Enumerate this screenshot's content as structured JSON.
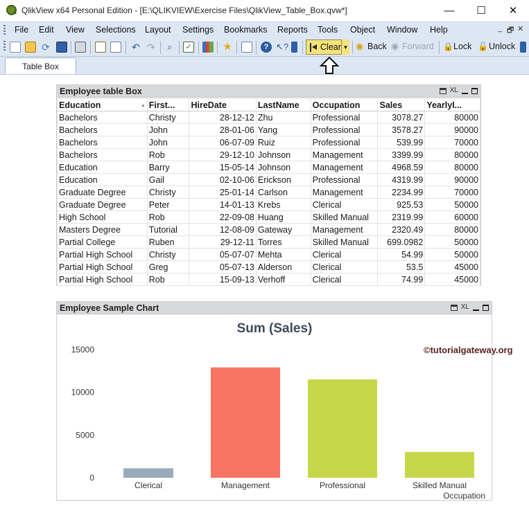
{
  "window": {
    "title": "QlikView x64 Personal Edition - [E:\\QLIKVIEW\\Exercise Files\\QlikView_Table_Box.qvw*]",
    "minimize": "—",
    "maximize": "☐",
    "close": "✕"
  },
  "menu": [
    "File",
    "Edit",
    "View",
    "Selections",
    "Layout",
    "Settings",
    "Bookmarks",
    "Reports",
    "Tools",
    "Object",
    "Window",
    "Help"
  ],
  "mdi_controls": {
    "minimize": "_",
    "restore": "🗗",
    "close": "✕"
  },
  "toolbar": {
    "clear_label": "Clear",
    "back_label": "Back",
    "forward_label": "Forward",
    "lock_label": "Lock",
    "unlock_label": "Unlock"
  },
  "tabs": [
    {
      "label": "Table Box"
    }
  ],
  "table_box": {
    "title": "Employee table Box",
    "xl_label": "XL",
    "columns": [
      "Education",
      "First...",
      "HireDate",
      "LastName",
      "Occupation",
      "Sales",
      "YearlyI..."
    ],
    "rows": [
      [
        "Bachelors",
        "Christy",
        "28-12-12",
        "Zhu",
        "Professional",
        "3078.27",
        "80000"
      ],
      [
        "Bachelors",
        "John",
        "28-01-06",
        "Yang",
        "Professional",
        "3578.27",
        "90000"
      ],
      [
        "Bachelors",
        "John",
        "06-07-09",
        "Ruiz",
        "Professional",
        "539.99",
        "70000"
      ],
      [
        "Bachelors",
        "Rob",
        "29-12-10",
        "Johnson",
        "Management",
        "3399.99",
        "80000"
      ],
      [
        "Education",
        "Barry",
        "15-05-14",
        "Johnson",
        "Management",
        "4968.59",
        "80000"
      ],
      [
        "Education",
        "Gail",
        "02-10-06",
        "Erickson",
        "Professional",
        "4319.99",
        "90000"
      ],
      [
        "Graduate Degree",
        "Christy",
        "25-01-14",
        "Carlson",
        "Management",
        "2234.99",
        "70000"
      ],
      [
        "Graduate Degree",
        "Peter",
        "14-01-13",
        "Krebs",
        "Clerical",
        "925.53",
        "50000"
      ],
      [
        "High School",
        "Rob",
        "22-09-08",
        "Huang",
        "Skilled Manual",
        "2319.99",
        "60000"
      ],
      [
        "Masters Degree",
        "Tutorial",
        "12-08-09",
        "Gateway",
        "Management",
        "2320.49",
        "80000"
      ],
      [
        "Partial College",
        "Ruben",
        "29-12-11",
        "Torres",
        "Skilled Manual",
        "699.0982",
        "50000"
      ],
      [
        "Partial High School",
        "Christy",
        "05-07-07",
        "Mehta",
        "Clerical",
        "54.99",
        "50000"
      ],
      [
        "Partial High School",
        "Greg",
        "05-07-13",
        "Alderson",
        "Clerical",
        "53.5",
        "45000"
      ],
      [
        "Partial High School",
        "Rob",
        "15-09-13",
        "Verhoff",
        "Clerical",
        "74.99",
        "45000"
      ]
    ]
  },
  "chart_object": {
    "caption": "Employee Sample Chart",
    "xl_label": "XL",
    "watermark": "©tutorialgateway.org"
  },
  "chart_data": {
    "type": "bar",
    "title": "Sum (Sales)",
    "xlabel": "Occupation",
    "ylabel": "",
    "categories": [
      "Clerical",
      "Management",
      "Professional",
      "Skilled Manual"
    ],
    "values": [
      1109.01,
      12923.06,
      11516.52,
      3019.99
    ],
    "colors": [
      "#9aaabd",
      "#f77563",
      "#c8d64a",
      "#c8d64a"
    ],
    "ylim": [
      0,
      15000
    ],
    "yticks": [
      "0",
      "5000",
      "10000",
      "15000"
    ],
    "grid": false,
    "legend": "none"
  }
}
